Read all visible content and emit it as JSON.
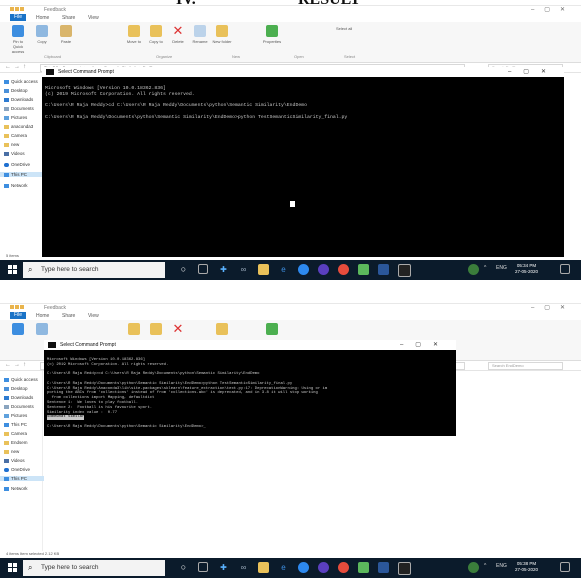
{
  "heading_left": "IV.",
  "heading_right": "RESULT",
  "screenshot_top": {
    "explorer": {
      "title": "Feedback",
      "ribbon_tabs": [
        "File",
        "Home",
        "Share",
        "View"
      ],
      "ribbon_buttons": [
        "Pin to Quick access",
        "Copy",
        "Paste",
        "Move to",
        "Copy to",
        "Delete",
        "Rename",
        "New folder",
        "Properties",
        "Select all"
      ],
      "ribbon_groups": [
        "Clipboard",
        "Organize",
        "New",
        "Open",
        "Select"
      ],
      "address": "This PC > Documents > python > Semantic Similarity > EndDemo",
      "search_placeholder": "Search EndDemo",
      "nav": [
        "Quick access",
        "Desktop",
        "Downloads",
        "Documents",
        "Pictures",
        "anaconda3",
        "Camera",
        "new",
        "Videos",
        "OneDrive",
        "This PC",
        "Network"
      ],
      "selected_nav": "This PC",
      "status": "5 items"
    },
    "cmd": {
      "title": "Select Command Prompt",
      "lines": [
        "Microsoft Windows [Version 10.0.18362.836]",
        "(c) 2019 Microsoft Corporation. All rights reserved.",
        "",
        "C:\\Users\\R Raja Reddy>cd C:\\Users\\R Raja Reddy\\Documents\\python\\Semantic Similarity\\EndDemo",
        "",
        "C:\\Users\\R Raja Reddy\\Documents\\python\\Semantic Similarity\\EndDemo>python TestSemanticSimilarity_final.py"
      ]
    },
    "taskbar": {
      "search_placeholder": "Type here to search",
      "lang": "ENG",
      "time": "05:34 PM",
      "date": "27-05-2020"
    }
  },
  "screenshot_bottom": {
    "explorer": {
      "title": "Feedback",
      "ribbon_tabs": [
        "File",
        "Home",
        "Share",
        "View"
      ],
      "address": "This PC > Documents > python > Semantic Similarity > EndDemo",
      "search_placeholder": "Search EndDemo",
      "nav": [
        "Quick access",
        "Desktop",
        "Downloads",
        "Documents",
        "Pictures",
        "This PC",
        "Camera",
        "Endsem",
        "new",
        "Videos",
        "OneDrive",
        "This PC",
        "Network"
      ],
      "selected_nav": "This PC",
      "status": "4 items   Item selected  2.12 KB"
    },
    "cmd": {
      "title": "Select Command Prompt",
      "lines": [
        "Microsoft Windows [Version 10.0.18362.836]",
        "(c) 2019 Microsoft Corporation. All rights reserved.",
        "",
        "C:\\Users\\R Raja Reddy>cd C:\\Users\\R Raja Reddy\\Documents\\python\\Semantic Similarity\\EndDemo",
        "",
        "C:\\Users\\R Raja Reddy\\Documents\\python\\Semantic Similarity\\EndDemo>python TestSemanticSimilarity_final.py",
        "C:\\Users\\R Raja Reddy\\Anaconda3\\lib\\site-packages\\sklearn\\feature_extraction\\text.py:17: DeprecationWarning: Using or im",
        "porting the ABCs from 'collections' instead of from 'collections.abc' is deprecated, and in 3.8 it will stop working",
        "  from collections import Mapping, defaultdict",
        "Sentence 1:  We loves to play football.",
        "Sentence 2:  Football is his favourite sport.",
        "Similarity index value :  0.77",
        "Somewhat Similar",
        "",
        "C:\\Users\\R Raja Reddy\\Documents\\python\\Semantic Similarity\\EndDemo>_"
      ]
    },
    "taskbar": {
      "search_placeholder": "Type here to search",
      "lang": "ENG",
      "time": "05:38 PM",
      "date": "27-05-2020"
    }
  }
}
